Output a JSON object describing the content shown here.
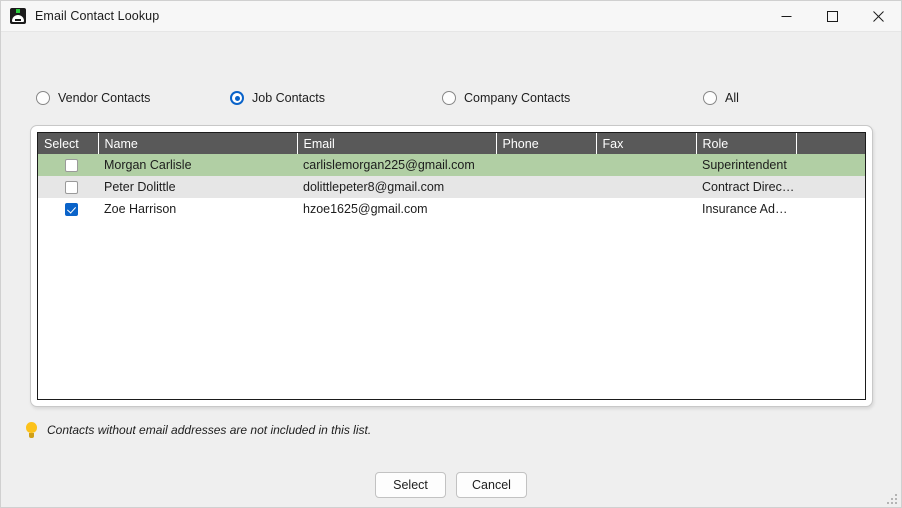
{
  "window": {
    "title": "Email Contact Lookup",
    "icon": "app-icon",
    "controls": {
      "minimize": "–",
      "maximize": "□",
      "close": "✕"
    }
  },
  "filters": {
    "options": [
      {
        "label": "Vendor Contacts",
        "selected": false
      },
      {
        "label": "Job Contacts",
        "selected": true
      },
      {
        "label": "Company Contacts",
        "selected": false
      },
      {
        "label": "All",
        "selected": false
      }
    ]
  },
  "grid": {
    "columns": [
      "Select",
      "Name",
      "Email",
      "Phone",
      "Fax",
      "Role",
      ""
    ],
    "rows": [
      {
        "checked": false,
        "name": "Morgan Carlisle",
        "email": "carlislemorgan225@gmail.com",
        "phone": "",
        "fax": "",
        "role": "Superintendent",
        "extra": ""
      },
      {
        "checked": false,
        "name": "Peter Dolittle",
        "email": "dolittlepeter8@gmail.com",
        "phone": "",
        "fax": "",
        "role": "Contract Director",
        "extra": ""
      },
      {
        "checked": true,
        "name": "Zoe Harrison",
        "email": "hzoe1625@gmail.com",
        "phone": "",
        "fax": "",
        "role": "Insurance Admini...",
        "extra": ""
      }
    ]
  },
  "hint": {
    "icon": "lightbulb-icon",
    "text": "Contacts without email addresses are not included in this list."
  },
  "actions": {
    "select_label": "Select",
    "cancel_label": "Cancel"
  },
  "colors": {
    "accent_blue": "#0a63c9",
    "selected_row_green": "#b1cfa4",
    "header_gray": "#595959",
    "alt_row_gray": "#e6e6e6"
  }
}
